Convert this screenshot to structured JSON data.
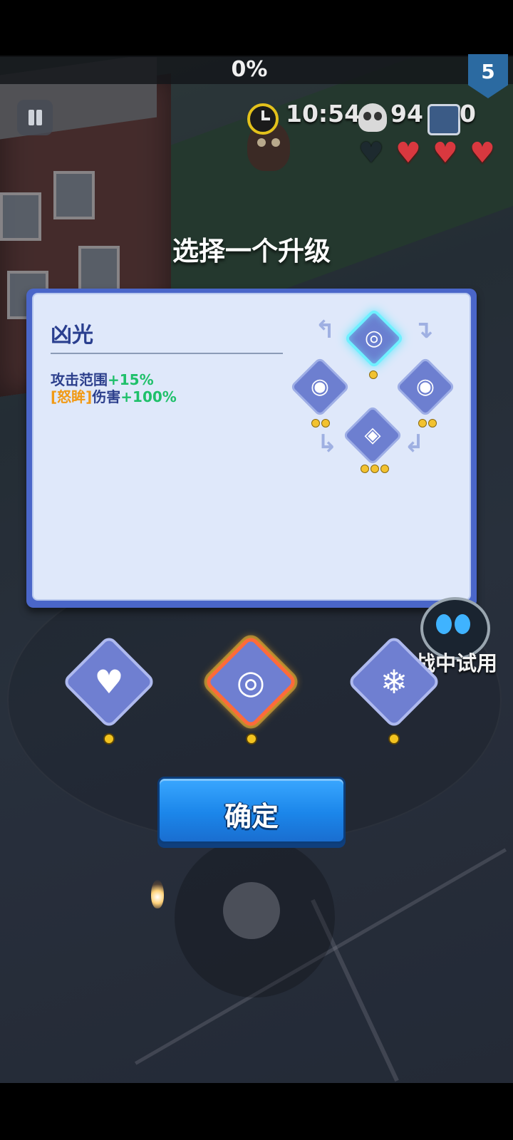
{
  "hud": {
    "progress": "0%",
    "level": "5",
    "timer": "10:54",
    "kills": "94",
    "chests": "0",
    "hearts": {
      "full": 3,
      "empty": 1
    }
  },
  "prompt_title": "选择一个升级",
  "info_panel": {
    "skill_name": "凶光",
    "line1": {
      "label": "攻击范围",
      "value": "+15%"
    },
    "line2": {
      "tag": "[怒眸]",
      "label": "伤害",
      "value": "+100%"
    },
    "tree": [
      {
        "name": "cannon-eye-icon",
        "level_dots": 1,
        "active": true
      },
      {
        "name": "fire-eye-icon",
        "level_dots": 2,
        "active": false
      },
      {
        "name": "flame-eye-icon",
        "level_dots": 2,
        "active": false
      },
      {
        "name": "winged-eye-icon",
        "level_dots": 3,
        "active": false
      }
    ]
  },
  "choices": [
    {
      "name": "heart-upgrade-icon",
      "selected": false
    },
    {
      "name": "cannon-eye-icon",
      "selected": true
    },
    {
      "name": "snowflake-icon",
      "selected": false
    }
  ],
  "side_label": "战中试用",
  "confirm_label": "确定",
  "colors": {
    "panel_border": "#4a66c9",
    "panel_bg": "#dfe8fa",
    "stat_green": "#1fc06a",
    "tag_orange": "#f19a16",
    "confirm_blue": "#1b86ea",
    "heart_red": "#d9383f"
  }
}
